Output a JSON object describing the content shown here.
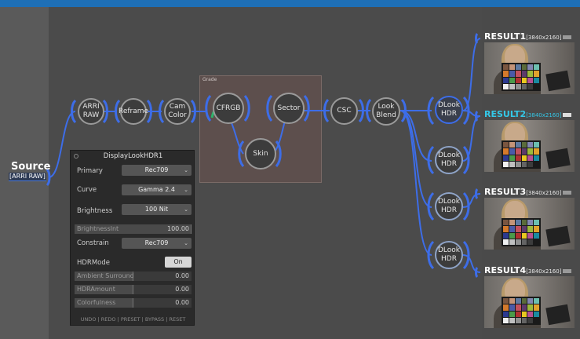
{
  "colors": {
    "accent": "#1e6fb6",
    "wire": "#3d6de8",
    "active_result": "#34c8e8"
  },
  "source": {
    "title": "Source",
    "subtitle": "[ARRI RAW]"
  },
  "grade": {
    "label": "Grade"
  },
  "nodes": {
    "arri_raw": "ARRI\nRAW",
    "reframe": "Reframe",
    "cam_color": "Cam\nColor",
    "cfrgb": "CFRGB",
    "sector": "Sector",
    "skin": "Skin",
    "csc": "CSC",
    "look_blend": "Look\nBlend",
    "dlook_1": "DLook\nHDR",
    "dlook_2": "DLook\nHDR",
    "dlook_3": "DLook\nHDR",
    "dlook_4": "DLook\nHDR"
  },
  "panel": {
    "title": "DisplayLookHDR1",
    "primary": {
      "label": "Primary",
      "value": "Rec709"
    },
    "curve": {
      "label": "Curve",
      "value": "Gamma 2.4"
    },
    "brightness": {
      "label": "Brightness",
      "value": "100 Nit"
    },
    "brightness_int": {
      "label": "BrightnessInt",
      "value": "100.00",
      "fill": 1.0
    },
    "constrain": {
      "label": "Constrain",
      "value": "Rec709"
    },
    "hdr_mode": {
      "label": "HDRMode",
      "value": "On"
    },
    "ambient_surround": {
      "label": "Ambient Surround",
      "value": "0.00",
      "fill": 0.0
    },
    "hdr_amount": {
      "label": "HDRAmount",
      "value": "0.00",
      "fill": 0.0
    },
    "colorfulness": {
      "label": "Colorfulness",
      "value": "0.00",
      "fill": 0.0
    },
    "footer": "UNDO | REDO | PRESET | BYPASS | RESET"
  },
  "results": [
    {
      "title": "RESULT1",
      "dims": "[3840x2160]",
      "active": false
    },
    {
      "title": "RESULT2",
      "dims": "[3840x2160]",
      "active": true
    },
    {
      "title": "RESULT3",
      "dims": "[3840x2160]",
      "active": false
    },
    {
      "title": "RESULT4",
      "dims": "[3840x2160]",
      "active": false
    }
  ]
}
